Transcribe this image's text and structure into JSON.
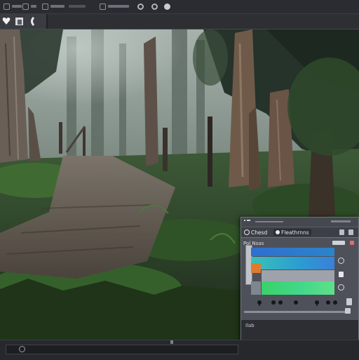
{
  "menu_bar": {
    "items": [
      {
        "icon": "square-icon"
      },
      {
        "icon": "square-icon"
      },
      {
        "icon": "bar-icon"
      },
      {
        "icon": "square-icon"
      },
      {
        "icon": "ring-icon"
      },
      {
        "icon": "ring-icon"
      },
      {
        "icon": "ring-filled-icon"
      }
    ]
  },
  "toolbar": {
    "tools": [
      "heart-icon",
      "cube-icon",
      "bracket-icon"
    ]
  },
  "panel": {
    "tabs": [
      {
        "label": "Chesd"
      },
      {
        "label": "Fleathrnns"
      }
    ],
    "section_label": "Pol Nsas",
    "foot_label": "Ilab",
    "accent": "#3a7fd9",
    "swatch_color": "#e07a2e",
    "gradient_colors": [
      "#2f6fd0",
      "#38c2b7",
      "#3ad16a"
    ]
  },
  "timeline": {
    "playhead_icon": "record-icon"
  }
}
